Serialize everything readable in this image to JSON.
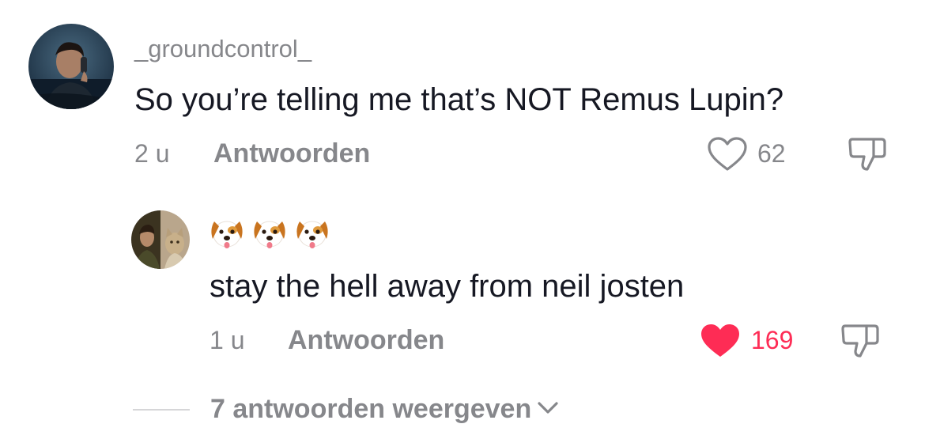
{
  "comment": {
    "username": "_groundcontrol_",
    "text": "So you’re telling me that’s NOT Remus Lupin?",
    "time": "2 u",
    "reply_label": "Antwoorden",
    "like_count": "62",
    "liked": false,
    "avatar_icon": "avatar-photo-man-on-phone"
  },
  "reply": {
    "username_emojis": [
      "dog-face-emoji",
      "dog-face-emoji",
      "dog-face-emoji"
    ],
    "text": "stay the hell away from neil josten",
    "time": "1 u",
    "reply_label": "Antwoorden",
    "like_count": "169",
    "liked": true,
    "avatar_icon": "avatar-photo-person-and-cat"
  },
  "view_replies": {
    "label": "7 antwoorden weergeven",
    "icon": "chevron-down-icon"
  },
  "colors": {
    "text_primary": "#161823",
    "text_secondary": "#86878b",
    "like_active": "#fe2c55"
  }
}
